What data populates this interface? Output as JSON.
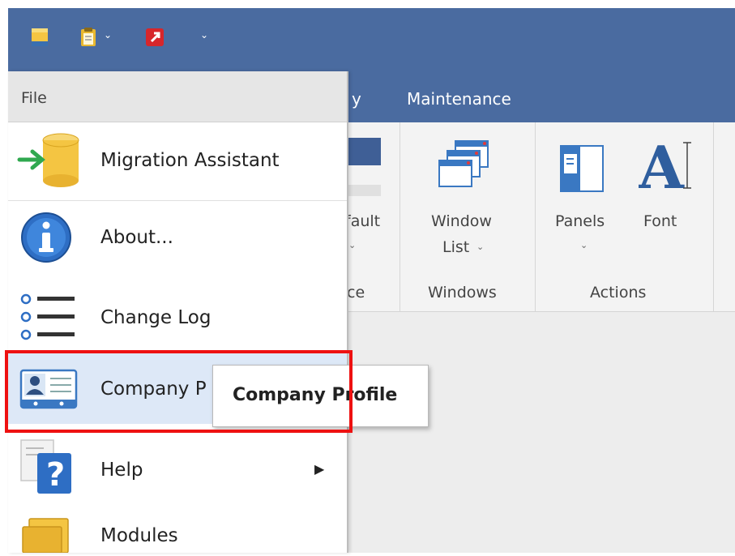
{
  "ribbon": {
    "tabs": [
      {
        "label": "y"
      },
      {
        "label": "Maintenance"
      }
    ],
    "items": {
      "default_partial": "fault",
      "window_list_line1": "Window",
      "window_list_line2": "List",
      "panels": "Panels",
      "font": "Font"
    },
    "groups": {
      "partial": "ce",
      "windows": "Windows",
      "actions": "Actions"
    }
  },
  "file_menu": {
    "header": "File",
    "items": [
      {
        "label": "Migration Assistant",
        "icon": "database-arrow-icon"
      },
      {
        "label": "About...",
        "icon": "info-icon"
      },
      {
        "label": "Change Log",
        "icon": "list-icon"
      },
      {
        "label": "Company P",
        "icon": "id-card-icon"
      },
      {
        "label": "Help",
        "icon": "help-icon",
        "has_submenu": true
      },
      {
        "label": "Modules",
        "icon": "modules-icon"
      }
    ]
  },
  "tooltip": {
    "text": "Company Profile"
  },
  "colors": {
    "titlebar": "#4a6ba0",
    "highlight": "#ee1111",
    "selected_item": "#dde8f7"
  }
}
